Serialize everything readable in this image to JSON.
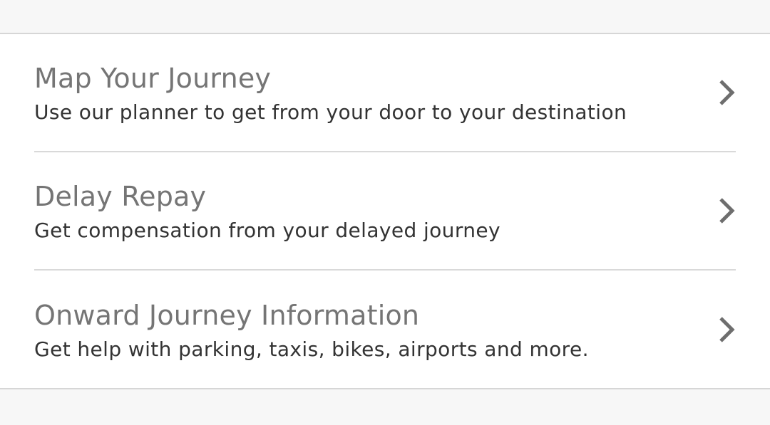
{
  "menu": {
    "items": [
      {
        "title": "Map Your Journey",
        "subtitle": "Use our planner to get from your door to your destination",
        "icon": "chevron-right-icon"
      },
      {
        "title": "Delay Repay",
        "subtitle": "Get compensation from your delayed journey",
        "icon": "chevron-right-icon"
      },
      {
        "title": "Onward Journey Information",
        "subtitle": "Get help with parking, taxis, bikes, airports and more.",
        "icon": "chevron-right-icon"
      }
    ]
  },
  "colors": {
    "background": "#f7f7f7",
    "card": "#ffffff",
    "title": "#757575",
    "subtitle": "#333333",
    "divider": "#d9d9d9",
    "chevron": "#6e6e6e"
  }
}
